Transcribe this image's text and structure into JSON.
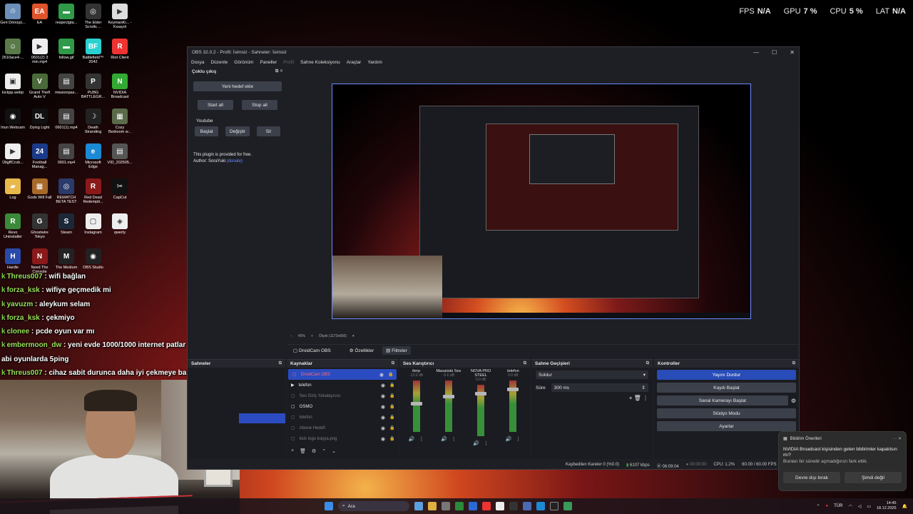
{
  "overlay_stats": [
    {
      "label": "FPS",
      "value": "N/A"
    },
    {
      "label": "GPU",
      "value": "7 %"
    },
    {
      "label": "CPU",
      "value": "5 %"
    },
    {
      "label": "LAT",
      "value": "N/A"
    }
  ],
  "desktop_icons": [
    {
      "label": "Geri Dönüşü...",
      "color": "#6b8fb8",
      "glyph": "♲"
    },
    {
      "label": "EA",
      "color": "#e0542b",
      "glyph": "EA"
    },
    {
      "label": "respectgta...",
      "color": "#2f9a48",
      "glyph": "▬"
    },
    {
      "label": "The Elder Scrolls ...",
      "color": "#333",
      "glyph": "◎"
    },
    {
      "label": "KeymanKi... - Kısayol",
      "color": "#ddd",
      "glyph": "▶"
    },
    {
      "label": "2610ace4-...",
      "color": "#5a7a4a",
      "glyph": "☺"
    },
    {
      "label": "0601(2) 3 min.mp4",
      "color": "#eee",
      "glyph": "▶"
    },
    {
      "label": "follow.gif",
      "color": "#2f9a48",
      "glyph": "▬"
    },
    {
      "label": "Battlefield™ 2042",
      "color": "#2ad1d1",
      "glyph": "BF"
    },
    {
      "label": "Riot Client",
      "color": "#e33",
      "glyph": "R"
    },
    {
      "label": "kickpp.webp",
      "color": "#eee",
      "glyph": "▣"
    },
    {
      "label": "Grand Theft Auto V",
      "color": "#4a6a3a",
      "glyph": "V"
    },
    {
      "label": "missionpas...",
      "color": "#444",
      "glyph": "▤"
    },
    {
      "label": "PUBG BATTLEGR...",
      "color": "#333",
      "glyph": "P"
    },
    {
      "label": "NVIDIA Broadcast",
      "color": "#3a3",
      "glyph": "N"
    },
    {
      "label": "Iriun Webcam",
      "color": "#111",
      "glyph": "◉"
    },
    {
      "label": "Dying Light",
      "color": "#111",
      "glyph": "DL"
    },
    {
      "label": "0601(1).mp4",
      "color": "#444",
      "glyph": "▤"
    },
    {
      "label": "Death Stranding",
      "color": "#222",
      "glyph": "☽"
    },
    {
      "label": "Cozy Bedroom w...",
      "color": "#5a6a4a",
      "glyph": "▦"
    },
    {
      "label": "ÜligffCcvb...",
      "color": "#eee",
      "glyph": "▶"
    },
    {
      "label": "Football Manag...",
      "color": "#1a3a8a",
      "glyph": "24"
    },
    {
      "label": "0601.mp4",
      "color": "#444",
      "glyph": "▤"
    },
    {
      "label": "Microsoft Edge",
      "color": "#1a8ad4",
      "glyph": "e"
    },
    {
      "label": "VID_202505...",
      "color": "#555",
      "glyph": "▤"
    },
    {
      "label": "Log",
      "color": "#e8b84a",
      "glyph": "▰"
    },
    {
      "label": "Gods Will Fall",
      "color": "#a86a2a",
      "glyph": "▦"
    },
    {
      "label": "REMATCH BETA TEST",
      "color": "#2a3a6a",
      "glyph": "◎"
    },
    {
      "label": "Red Dead Redempti...",
      "color": "#8a1a1a",
      "glyph": "R"
    },
    {
      "label": "CapCut",
      "color": "#111",
      "glyph": "✂"
    },
    {
      "label": "Revo Uninstaller",
      "color": "#3a8a3a",
      "glyph": "R"
    },
    {
      "label": "Ghostwire Tokyo",
      "color": "#333",
      "glyph": "G"
    },
    {
      "label": "Steam",
      "color": "#1b2838",
      "glyph": "S"
    },
    {
      "label": "Instagram",
      "color": "#eee",
      "glyph": "▢"
    },
    {
      "label": "qwerty",
      "color": "#eee",
      "glyph": "◈"
    },
    {
      "label": "Hardle",
      "color": "#2a4aaa",
      "glyph": "H"
    },
    {
      "label": "Need The Console",
      "color": "#8a1a1a",
      "glyph": "N"
    },
    {
      "label": "The Medium",
      "color": "#222",
      "glyph": "M"
    },
    {
      "label": "OBS Studio",
      "color": "#222",
      "glyph": "◉"
    }
  ],
  "chat": [
    {
      "user": "Threus007",
      "msg": " : wifi bağlan"
    },
    {
      "user": "forza_ksk",
      "msg": " : wifiye geçmedik mi"
    },
    {
      "user": "yavuzm",
      "msg": " : aleykum selam"
    },
    {
      "user": "forza_ksk",
      "msg": " : çekmiyo"
    },
    {
      "user": "clonee",
      "msg": " : pcde oyun var mı"
    },
    {
      "user": "embermoon_dw",
      "msg": " : yeni evde 1000/1000 internet patlar"
    },
    {
      "user": "",
      "msg": "abi oyunlarda 5ping"
    },
    {
      "user": "Threus007",
      "msg": " : cihaz sabit durunca daha iyi çekmeye başladı"
    }
  ],
  "obs": {
    "title": "OBS 32.0.2 - Profil: İsimsiz - Sahneler: İsimsiz",
    "window_controls": [
      "—",
      "☐",
      "✕"
    ],
    "menu": [
      "Dosya",
      "Düzenle",
      "Görünüm",
      "Paneller",
      "Profil",
      "Sahne Koleksiyonu",
      "Araçlar",
      "Yardım"
    ],
    "plugin_dock": {
      "title": "Çoklu çıkış",
      "add_target": "Yeni hedef ekle",
      "start_all": "Start all",
      "stop_all": "Stop all",
      "target_name": "Youtube",
      "start": "Başlat",
      "edit": "Değiştir",
      "delete": "Sil",
      "info1": "This plugin is provided for free.",
      "info2_prefix": "Author: SoraYuki ",
      "info2_link": "(donate)"
    },
    "zoom": {
      "percent": "45%",
      "scale_label": "Ölçek (1173x660)"
    },
    "source_toolbar": {
      "source": "DroidCam OBS",
      "properties": "Özellikler",
      "filters": "Filtreler"
    },
    "scenes": {
      "title": "Sahneler"
    },
    "sources": {
      "title": "Kaynaklar",
      "items": [
        {
          "name": "DroidCam OBS",
          "state": "sel"
        },
        {
          "name": "telefon",
          "state": "group"
        },
        {
          "name": "Ses Giriş Yakalayıcısı",
          "state": "dim"
        },
        {
          "name": "OSMO",
          "state": "normal"
        },
        {
          "name": "telefon",
          "state": "dim"
        },
        {
          "name": "Abone Hedefi",
          "state": "dim"
        },
        {
          "name": "kick logo kopya.png",
          "state": "dim"
        }
      ]
    },
    "mixer": {
      "title": "Ses Karıştırıcı",
      "channels": [
        {
          "name": "ibrrp",
          "db": "-13.0 dB",
          "level": 0.55
        },
        {
          "name": "Masaüstü Ses",
          "db": "-5.6 dB",
          "level": 0.7
        },
        {
          "name": "NOVA PRO STEEL",
          "db": "0.0 dB",
          "level": 0.85
        },
        {
          "name": "telefon",
          "db": "0.0 dB",
          "level": 0.85
        }
      ]
    },
    "transitions": {
      "title": "Sahne Geçişleri",
      "selected": "Soldur",
      "duration_label": "Süre",
      "duration": "300 ms"
    },
    "controls": {
      "title": "Kontroller",
      "stop_stream": "Yayını Durdur",
      "start_record": "Kaydı Başlat",
      "virtual_cam": "Sanal Kamerayı Başlat",
      "studio_mode": "Stüdyo Modu",
      "settings": "Ayarlar"
    },
    "status": {
      "dropped": "Kaybedilen Kareler 0 (%0.0)",
      "bitrate": "6107 kbps",
      "stream_time": "06:09:04",
      "rec_time": "00:00:00",
      "cpu": "CPU: 1.2%",
      "fps": "60.00 / 60.00 FPS"
    }
  },
  "notification": {
    "app": "Bildirim Önerileri",
    "text": "NVIDIA Broadcast  kişisinden gelen bildirimler kapatılsın mı?",
    "sub": "Bunları bir süredir açmadığınızı fark ettik.",
    "btn_off": "Devre dışı bırak",
    "btn_later": "Şimdi değil"
  },
  "taskbar": {
    "search": "Ara",
    "lang": "TÜR",
    "time": "14:45",
    "date": "18.12.2025"
  }
}
